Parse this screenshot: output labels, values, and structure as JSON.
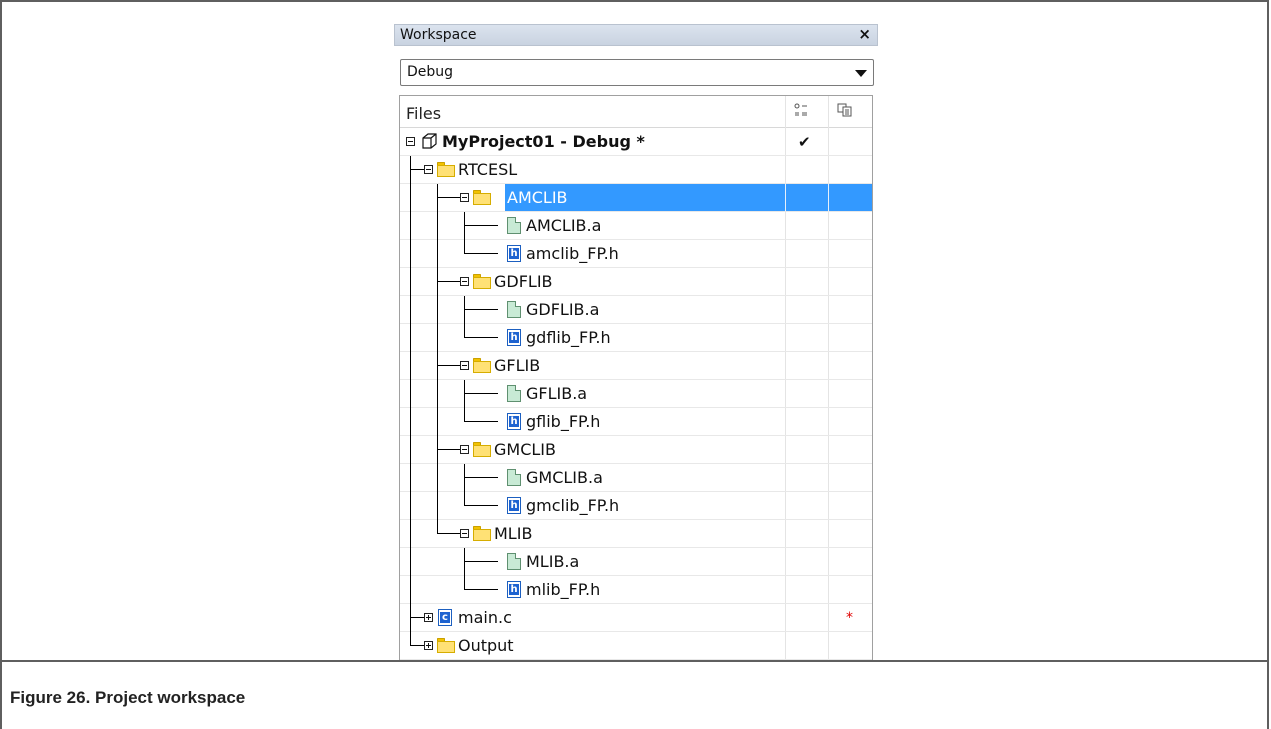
{
  "workspace": {
    "title": "Workspace",
    "close_glyph": "×",
    "configuration": "Debug",
    "header": {
      "files_label": "Files",
      "col1_icon": "make-options-icon",
      "col2_icon": "file-properties-icon"
    }
  },
  "tree": {
    "project": {
      "label": "MyProject01 - Debug *",
      "check": "✔"
    },
    "folder_rtcesl": "RTCESL",
    "folder_amclib": "AMCLIB",
    "file_amclib_a": "AMCLIB.a",
    "file_amclib_h": "amclib_FP.h",
    "folder_gdflib": "GDFLIB",
    "file_gdflib_a": "GDFLIB.a",
    "file_gdflib_h": "gdflib_FP.h",
    "folder_gflib": "GFLIB",
    "file_gflib_a": "GFLIB.a",
    "file_gflib_h": "gflib_FP.h",
    "folder_gmclib": "GMCLIB",
    "file_gmclib_a": "GMCLIB.a",
    "file_gmclib_h": "gmclib_FP.h",
    "folder_mlib": "MLIB",
    "file_mlib_a": "MLIB.a",
    "file_mlib_h": "mlib_FP.h",
    "file_main_c": "main.c",
    "main_c_mark": "*",
    "folder_output": "Output"
  },
  "icons": {
    "h_glyph": "h",
    "c_glyph": "c"
  },
  "caption": "Figure 26.  Project workspace",
  "colors": {
    "selection": "#3399ff",
    "titlebar": "#cfd8e5",
    "folder": "#ffe175"
  }
}
